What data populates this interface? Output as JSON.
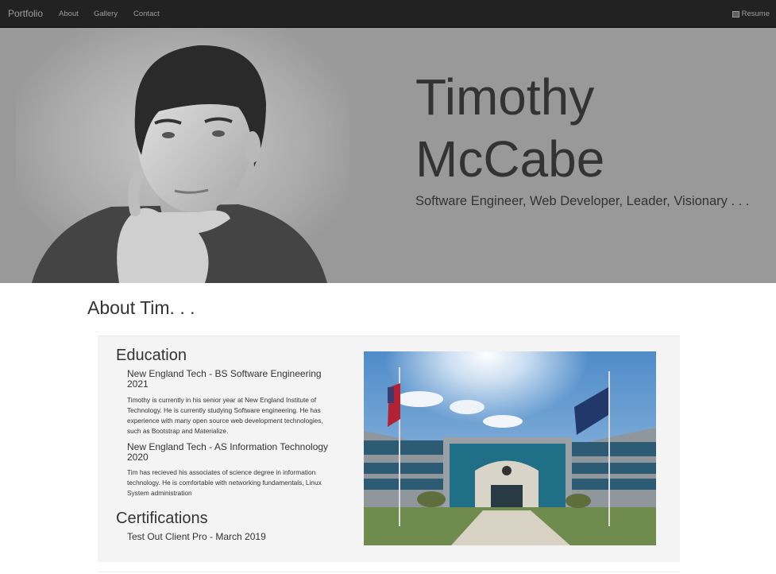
{
  "nav": {
    "brand": "Portfolio",
    "links": [
      "About",
      "Gallery",
      "Contact"
    ],
    "resume_label": "Resume",
    "resume_icon": "document-icon"
  },
  "hero": {
    "name_line1": "Timothy",
    "name_line2": "McCabe",
    "tagline": "Software Engineer, Web Developer, Leader, Visionary . . ."
  },
  "about": {
    "heading": "About Tim. . .",
    "education_title": "Education",
    "education": [
      {
        "title": "New England Tech - BS Software Engineering 2021",
        "description": "Timothy is currently in his senior year at New England Institute of Technology. He is currently studying Software engineering. He has experience with many open source web development technologies, such as Bootstrap and Materialize."
      },
      {
        "title": "New England Tech - AS Information Technology 2020",
        "description": "Tim has recieved his associates of science degree in information technology. He is comfortable with networking fundamentals, Linux System administration"
      }
    ],
    "certifications_title": "Certifications",
    "certifications": [
      "Test Out Client Pro - March 2019"
    ]
  },
  "colors": {
    "navbar": "#222222",
    "nav_text": "#9d9d9d",
    "hero_bg": "#999999",
    "panel_bg": "#f4f4f4",
    "text": "#333333"
  }
}
